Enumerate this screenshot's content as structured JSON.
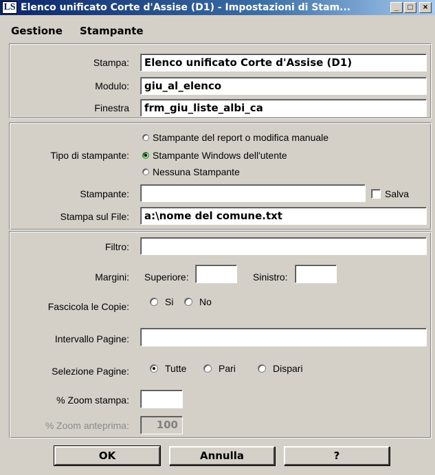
{
  "window": {
    "title": "Elenco unificato Corte d'Assise (D1) - Impostazioni di Stam...",
    "minimize": "_",
    "maximize": "□",
    "close": "×"
  },
  "menu": {
    "gestione": "Gestione",
    "stampante": "Stampante"
  },
  "report": {
    "stampa_label": "Stampa:",
    "stampa_value": "Elenco unificato Corte d'Assise (D1)",
    "modulo_label": "Modulo:",
    "modulo_value": "giu_al_elenco",
    "finestra_label": "Finestra",
    "finestra_value": "frm_giu_liste_albi_ca"
  },
  "printer": {
    "tipo_label": "Tipo di stampante:",
    "option_report": "Stampante del report o modifica manuale",
    "option_windows": "Stampante Windows dell'utente",
    "option_none": "Nessuna Stampante",
    "selected": "option_windows",
    "stampante_label": "Stampante:",
    "stampante_value": "",
    "salva_label": "Salva",
    "file_label": "Stampa sul File:",
    "file_value": "a:\\nome del comune.txt"
  },
  "options": {
    "filtro_label": "Filtro:",
    "filtro_value": "",
    "margini_label": "Margini:",
    "superiore_label": "Superiore:",
    "superiore_value": "",
    "sinistro_label": "Sinistro:",
    "sinistro_value": "",
    "fascicola_label": "Fascicola le Copie:",
    "si_label": "Si",
    "no_label": "No",
    "intervallo_label": "Intervallo Pagine:",
    "intervallo_value": "",
    "selezione_label": "Selezione Pagine:",
    "tutte_label": "Tutte",
    "pari_label": "Pari",
    "dispari_label": "Dispari",
    "selezione_selected": "Tutte",
    "zoom_stampa_label": "% Zoom stampa:",
    "zoom_stampa_value": "",
    "zoom_anteprima_label": "% Zoom anteprima:",
    "zoom_anteprima_value": "100"
  },
  "buttons": {
    "ok": "OK",
    "annulla": "Annulla",
    "help": "?"
  }
}
